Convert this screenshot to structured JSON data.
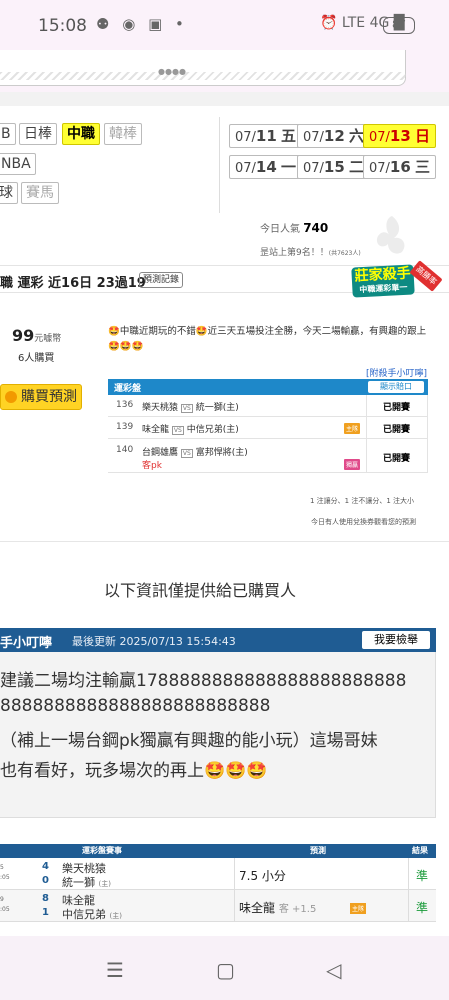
{
  "status_bar": {
    "time": "15:08",
    "left_icons": "⚉ ◉ ▣ •",
    "right_icons": "⏰ LTE 4G █",
    "battery": "87"
  },
  "sports": {
    "row1": [
      "B",
      "日棒",
      "中職",
      "韓棒"
    ],
    "row2": [
      "NBA"
    ],
    "row3": [
      "球",
      "賽馬"
    ]
  },
  "dates": [
    {
      "md": "07/",
      "d": "11",
      "wd": "五"
    },
    {
      "md": "07/",
      "d": "12",
      "wd": "六"
    },
    {
      "md": "07/",
      "d": "13",
      "wd": "日"
    },
    {
      "md": "07/",
      "d": "14",
      "wd": "一"
    },
    {
      "md": "07/",
      "d": "15",
      "wd": "二"
    },
    {
      "md": "07/",
      "d": "16",
      "wd": "三"
    }
  ],
  "popularity": {
    "label": "今日人氣",
    "value": "740",
    "rank": "昰站上第9名！！",
    "rank_small": "(共7623人)"
  },
  "predictor": {
    "line_text": "職 運彩 近16日 23過19",
    "record_button": "預測記錄",
    "logo_title": "莊家殺手",
    "logo_sub": "中職運彩單一",
    "ribbon": "高勝率"
  },
  "purchase": {
    "price": "99",
    "price_unit": "元噱幣",
    "buyers": "6人購買",
    "buy_label": "購買預測"
  },
  "note": "🤩中職近期玩的不錯🤩近三天五場投注全勝，今天二場輸贏，有興趣的跟上🤩🤩🤩",
  "help_link": "[附殺手小叮嚀]",
  "lottery_table": {
    "title": "運彩盤",
    "button": "顯示賠口",
    "rows": [
      {
        "num": "136",
        "away": "樂天桃猿",
        "vs": "VS",
        "home": "統一獅(主)",
        "chip": "",
        "sub": "",
        "result": "已開賽"
      },
      {
        "num": "139",
        "away": "味全龍",
        "vs": "VS",
        "home": "中信兄弟(主)",
        "chip": "主隊",
        "sub": "",
        "result": "已開賽"
      },
      {
        "num": "140",
        "away": "台鋼雄鷹",
        "vs": "VS",
        "home": "富邦悍將(主)",
        "chip": "獨贏",
        "sub": "客pk",
        "result": "已開賽"
      }
    ]
  },
  "footnote1": "1 注讓分、1 注不讓分、1 注大小",
  "footnote2": "今日有人使用兌換券觀看您的預測",
  "only_buyers": "以下資訊僅提供給已購買人",
  "tips": {
    "title": "手小叮嚀",
    "updated": "最後更新 2025/07/13 15:54:43",
    "report_button": "我要檢舉",
    "lines": [
      "建議二場均注輸贏1788888888888888888888888",
      "8888888888888888888888888",
      "（補上一場台鋼pk獨贏有興趣的能小玩）這場哥妹",
      "也有看好，玩多場次的再上🤩🤩🤩"
    ]
  },
  "result_table": {
    "headers": [
      "運彩盤賽事",
      "預測",
      "結果"
    ],
    "rows": [
      {
        "g1": "5",
        "g2": ":05",
        "s1": "4",
        "s2": "0",
        "t1": "樂天桃猿",
        "t2": "統一獅",
        "t2s": "(主)",
        "pred": "7.5 小分",
        "pred_sub": "",
        "chip": "",
        "res": "準"
      },
      {
        "g1": "9",
        "g2": ":05",
        "s1": "8",
        "s2": "1",
        "t1": "味全龍",
        "t2": "中信兄弟",
        "t2s": "(主)",
        "pred": "味全龍",
        "pred_sub": "客 +1.5",
        "chip": "主隊",
        "res": "準"
      }
    ]
  },
  "nav": {
    "recent": "☰",
    "home": "▢",
    "back": "◁"
  },
  "colors": {
    "accent_blue": "#1f5c93",
    "table_blue": "#1e88c9",
    "highlight_yellow": "#ffff33",
    "win_green": "#1a9b3a"
  }
}
